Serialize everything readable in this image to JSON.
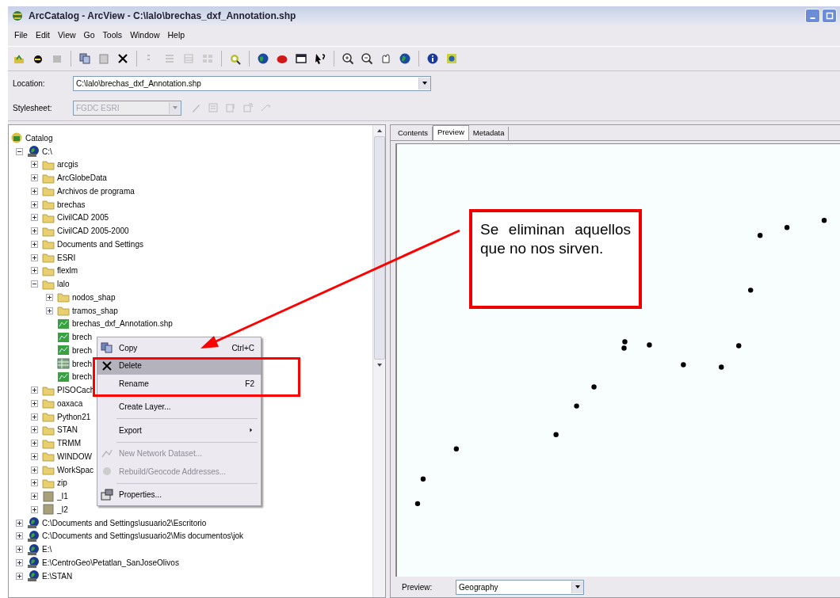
{
  "window": {
    "title": "ArcCatalog - ArcView - C:\\lalo\\brechas_dxf_Annotation.shp"
  },
  "menu_bar": [
    "File",
    "Edit",
    "View",
    "Go",
    "Tools",
    "Window",
    "Help"
  ],
  "location": {
    "label": "Location:",
    "value": "C:\\lalo\\brechas_dxf_Annotation.shp"
  },
  "stylesheet": {
    "label": "Stylesheet:",
    "value": "FGDC ESRI",
    "disabled": true
  },
  "catalog_tree": [
    {
      "label": "Catalog",
      "kind": "catalog",
      "children": [
        {
          "label": "C:\\",
          "kind": "drive",
          "expanded": true,
          "children": [
            {
              "label": "arcgis",
              "kind": "folder",
              "expanded": false
            },
            {
              "label": "ArcGlobeData",
              "kind": "folder",
              "expanded": false
            },
            {
              "label": "Archivos de programa",
              "kind": "folder",
              "expanded": false
            },
            {
              "label": "brechas",
              "kind": "folder",
              "expanded": false
            },
            {
              "label": "CivilCAD 2005",
              "kind": "folder",
              "expanded": false
            },
            {
              "label": "CivilCAD 2005-2000",
              "kind": "folder",
              "expanded": false
            },
            {
              "label": "Documents and Settings",
              "kind": "folder",
              "expanded": false
            },
            {
              "label": "ESRI",
              "kind": "folder",
              "expanded": false
            },
            {
              "label": "flexlm",
              "kind": "folder",
              "expanded": false
            },
            {
              "label": "lalo",
              "kind": "folder",
              "expanded": true,
              "children": [
                {
                  "label": "nodos_shap",
                  "kind": "folder",
                  "expanded": false
                },
                {
                  "label": "tramos_shap",
                  "kind": "folder",
                  "expanded": false
                },
                {
                  "label": "brechas_dxf_Annotation.shp",
                  "kind": "shapefile"
                },
                {
                  "label": "brech",
                  "kind": "shapefile"
                },
                {
                  "label": "brech",
                  "kind": "shapefile"
                },
                {
                  "label": "brech",
                  "kind": "table"
                },
                {
                  "label": "brech",
                  "kind": "shapefile"
                }
              ]
            },
            {
              "label": "PISOCach",
              "kind": "folder",
              "expanded": false
            },
            {
              "label": "oaxaca",
              "kind": "folder",
              "expanded": false
            },
            {
              "label": "Python21",
              "kind": "folder",
              "expanded": false
            },
            {
              "label": "STAN",
              "kind": "folder",
              "expanded": false
            },
            {
              "label": "TRMM",
              "kind": "folder",
              "expanded": false
            },
            {
              "label": "WINDOW",
              "kind": "folder",
              "expanded": false
            },
            {
              "label": "WorkSpac",
              "kind": "folder",
              "expanded": false
            },
            {
              "label": "zip",
              "kind": "folder",
              "expanded": false
            },
            {
              "label": "_I1",
              "kind": "raster",
              "expanded": false
            },
            {
              "label": "_I2",
              "kind": "raster",
              "expanded": false
            }
          ]
        },
        {
          "label": "C:\\Documents and Settings\\usuario2\\Escritorio",
          "kind": "drive",
          "expanded": false
        },
        {
          "label": "C:\\Documents and Settings\\usuario2\\Mis documentos\\jok",
          "kind": "drive",
          "expanded": false
        },
        {
          "label": "E:\\",
          "kind": "drive",
          "expanded": false
        },
        {
          "label": "E:\\CentroGeo\\Petatlan_SanJoseOlivos",
          "kind": "drive",
          "expanded": false
        },
        {
          "label": "E:\\STAN",
          "kind": "drive",
          "expanded": false
        }
      ]
    }
  ],
  "context_menu": [
    {
      "kind": "item",
      "label": "Copy",
      "shortcut": "Ctrl+C",
      "disabled": false,
      "selected": false,
      "submenu": false
    },
    {
      "kind": "item",
      "label": "Delete",
      "disabled": false,
      "selected": true,
      "submenu": false
    },
    {
      "kind": "item",
      "label": "Rename",
      "shortcut": "F2",
      "disabled": false,
      "selected": false,
      "submenu": false
    },
    {
      "kind": "separator"
    },
    {
      "kind": "item",
      "label": "Create Layer...",
      "disabled": false,
      "selected": false,
      "submenu": false
    },
    {
      "kind": "separator"
    },
    {
      "kind": "item",
      "label": "Export",
      "disabled": false,
      "selected": false,
      "submenu": true
    },
    {
      "kind": "separator"
    },
    {
      "kind": "item",
      "label": "New Network Dataset...",
      "disabled": true,
      "selected": false,
      "submenu": false
    },
    {
      "kind": "item",
      "label": "Rebuild/Geocode Addresses...",
      "disabled": true,
      "selected": false,
      "submenu": false
    },
    {
      "kind": "separator"
    },
    {
      "kind": "item",
      "label": "Properties...",
      "disabled": false,
      "selected": false,
      "submenu": false
    }
  ],
  "tabs": [
    {
      "label": "Contents",
      "selected": false
    },
    {
      "label": "Preview",
      "selected": true
    },
    {
      "label": "Metadata",
      "selected": false
    }
  ],
  "preview_bar": {
    "label": "Preview:",
    "value": "Geography"
  },
  "callout": {
    "text": "Se eliminan aquellos que no nos sirven."
  }
}
